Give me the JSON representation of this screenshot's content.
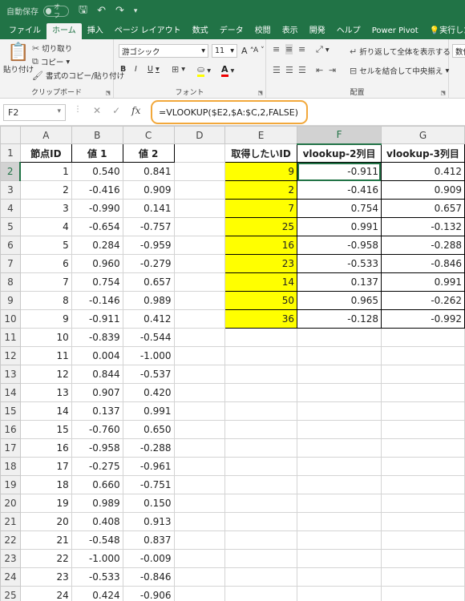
{
  "titlebar": {
    "autosave": "自動保存",
    "toggle": "オフ"
  },
  "tabs": [
    "ファイル",
    "ホーム",
    "挿入",
    "ページ レイアウト",
    "数式",
    "データ",
    "校閲",
    "表示",
    "開発",
    "ヘルプ",
    "Power Pivot",
    "実行したい"
  ],
  "ribbon": {
    "clipboard": {
      "paste": "貼り付け",
      "cut": "切り取り",
      "copy": "コピー",
      "format_painter": "書式のコピー/貼り付け",
      "label": "クリップボード"
    },
    "font": {
      "name": "游ゴシック",
      "size": "11",
      "bold": "B",
      "italic": "I",
      "underline": "U",
      "grow": "A",
      "shrink": "A",
      "label": "フォント"
    },
    "alignment": {
      "wrap": "折り返して全体を表示する",
      "merge": "セルを結合して中央揃え",
      "label": "配置"
    },
    "number": {
      "format": "数値"
    }
  },
  "formula_bar": {
    "name_box": "F2",
    "formula": "=VLOOKUP($E2,$A:$C,2,FALSE)",
    "fx": "fx"
  },
  "columns": [
    "A",
    "B",
    "C",
    "D",
    "E",
    "F",
    "G"
  ],
  "selected_column": "F",
  "selected_row": 2,
  "headers": {
    "A": "節点ID",
    "B": "値 1",
    "C": "値 2",
    "E": "取得したいID",
    "F": "vlookup-2列目",
    "G": "vlookup-3列目"
  },
  "data_rows": [
    [
      "1",
      "0.540",
      "0.841"
    ],
    [
      "2",
      "-0.416",
      "0.909"
    ],
    [
      "3",
      "-0.990",
      "0.141"
    ],
    [
      "4",
      "-0.654",
      "-0.757"
    ],
    [
      "5",
      "0.284",
      "-0.959"
    ],
    [
      "6",
      "0.960",
      "-0.279"
    ],
    [
      "7",
      "0.754",
      "0.657"
    ],
    [
      "8",
      "-0.146",
      "0.989"
    ],
    [
      "9",
      "-0.911",
      "0.412"
    ],
    [
      "10",
      "-0.839",
      "-0.544"
    ],
    [
      "11",
      "0.004",
      "-1.000"
    ],
    [
      "12",
      "0.844",
      "-0.537"
    ],
    [
      "13",
      "0.907",
      "0.420"
    ],
    [
      "14",
      "0.137",
      "0.991"
    ],
    [
      "15",
      "-0.760",
      "0.650"
    ],
    [
      "16",
      "-0.958",
      "-0.288"
    ],
    [
      "17",
      "-0.275",
      "-0.961"
    ],
    [
      "18",
      "0.660",
      "-0.751"
    ],
    [
      "19",
      "0.989",
      "0.150"
    ],
    [
      "20",
      "0.408",
      "0.913"
    ],
    [
      "21",
      "-0.548",
      "0.837"
    ],
    [
      "22",
      "-1.000",
      "-0.009"
    ],
    [
      "23",
      "-0.533",
      "-0.846"
    ],
    [
      "24",
      "0.424",
      "-0.906"
    ],
    [
      "25",
      "0.991",
      "-0.132"
    ]
  ],
  "lookup_rows": [
    [
      "9",
      "-0.911",
      "0.412"
    ],
    [
      "2",
      "-0.416",
      "0.909"
    ],
    [
      "7",
      "0.754",
      "0.657"
    ],
    [
      "25",
      "0.991",
      "-0.132"
    ],
    [
      "16",
      "-0.958",
      "-0.288"
    ],
    [
      "23",
      "-0.533",
      "-0.846"
    ],
    [
      "14",
      "0.137",
      "0.991"
    ],
    [
      "50",
      "0.965",
      "-0.262"
    ],
    [
      "36",
      "-0.128",
      "-0.992"
    ]
  ],
  "colors": {
    "accent": "#217346",
    "highlight": "#ffff00",
    "formula_outline": "#f2a83b"
  }
}
